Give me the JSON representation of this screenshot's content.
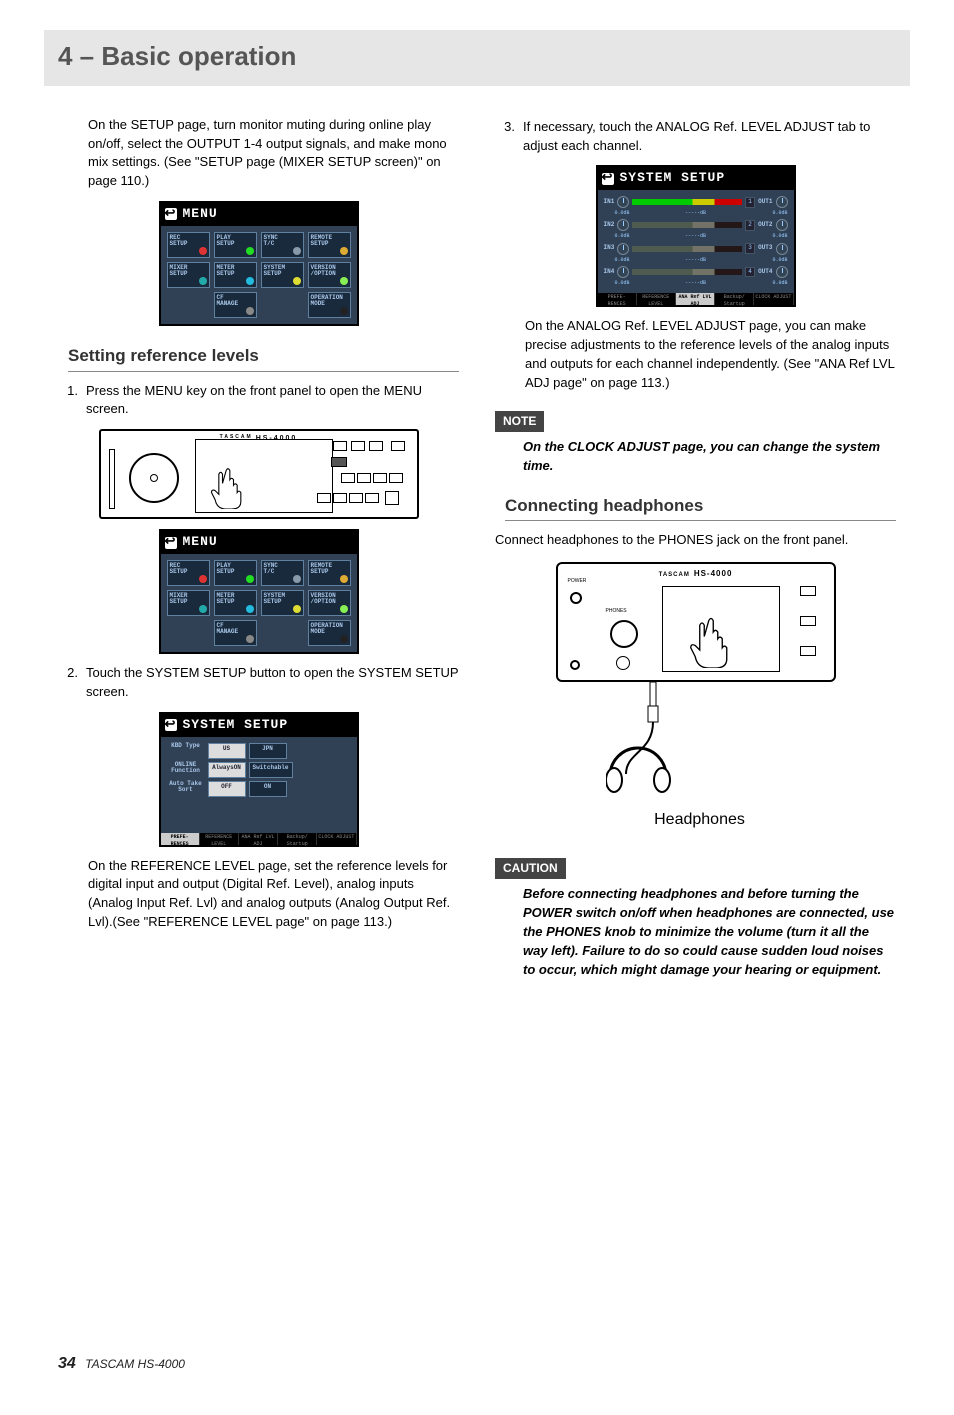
{
  "chapter_title": "4 – Basic operation",
  "left": {
    "intro": "On the SETUP page, turn monitor muting during online play on/off, select the OUTPUT 1-4 output signals, and make mono mix settings. (See \"SETUP page (MIXER SETUP screen)\" on page 110.)",
    "section_title": "Setting reference levels",
    "steps": [
      "Press the MENU key on the front panel to open the MENU screen.",
      "Touch the SYSTEM SETUP button to open the SYSTEM SETUP screen."
    ],
    "ref_para": "On the REFERENCE LEVEL page, set the reference levels for digital input and output (Digital Ref. Level), analog inputs (Analog Input Ref. Lvl) and analog outputs (Analog Output Ref. Lvl).(See \"REFERENCE LEVEL page\" on page 113.)"
  },
  "panel_model": "HS-4000",
  "menu": {
    "title": "MENU",
    "buttons": [
      {
        "label": "REC\nSETUP",
        "dot": "#d33"
      },
      {
        "label": "PLAY\nSETUP",
        "dot": "#2d2"
      },
      {
        "label": "SYNC\nT/C",
        "dot": "#89a"
      },
      {
        "label": "REMOTE\nSETUP",
        "dot": "#da3"
      },
      {
        "label": "MIXER\nSETUP",
        "dot": "#2aa"
      },
      {
        "label": "METER\nSETUP",
        "dot": "#2bd"
      },
      {
        "label": "SYSTEM\nSETUP",
        "dot": "#dd3"
      },
      {
        "label": "VERSION\n/OPTION",
        "dot": "#8e5"
      },
      {
        "label": "",
        "gap": true
      },
      {
        "label": "CF\nMANAGE",
        "dot": "#888"
      },
      {
        "label": "",
        "gap": true
      },
      {
        "label": "OPERATION\nMODE",
        "dot": "#222"
      }
    ]
  },
  "system_setup": {
    "title": "SYSTEM SETUP",
    "rows": [
      {
        "label": "KBD\nType",
        "buttons": [
          {
            "t": "US",
            "hi": true
          },
          {
            "t": "JPN"
          }
        ]
      },
      {
        "label": "ONLINE\nFunction",
        "buttons": [
          {
            "t": "AlwaysON",
            "hi": true
          },
          {
            "t": "Switchable"
          }
        ]
      },
      {
        "label": "Auto\nTake\nSort",
        "buttons": [
          {
            "t": "OFF",
            "hi": true
          },
          {
            "t": "ON"
          }
        ]
      }
    ],
    "tabs": [
      "PREFE-\nRENCES",
      "REFERENCE\nLEVEL",
      "ANA Ref\nLVL ADJ",
      "Backup/\nStartup",
      "CLOCK\nADJUST"
    ],
    "active_tab": 0
  },
  "right": {
    "step3": "If necessary, touch the ANALOG Ref. LEVEL ADJUST tab to adjust each channel.",
    "ana_para": "On the ANALOG Ref. LEVEL ADJUST page, you can make precise adjustments to the reference levels of the analog inputs and outputs for each channel independently. (See \"ANA Ref LVL ADJ page\" on page 113.)",
    "note_label": "NOTE",
    "note_body": "On the CLOCK ADJUST page, you can change the system time.",
    "conn_title": "Connecting headphones",
    "conn_para": "Connect headphones to the PHONES jack on the front panel.",
    "hp_label": "Headphones",
    "caution_label": "CAUTION",
    "caution_body": "Before connecting headphones and before turning the POWER switch on/off when headphones are connected, use the PHONES knob to minimize the volume (turn it all the way left).  Failure to do so could cause sudden loud noises to occur, which might damage your hearing or equipment."
  },
  "ana_adjust": {
    "title": "SYSTEM SETUP",
    "channels": [
      {
        "in": "IN1",
        "in_db": "0.0dB",
        "meter": "-----dB",
        "idx": "1",
        "out": "OUT1",
        "out_db": "0.0dB"
      },
      {
        "in": "IN2",
        "in_db": "0.0dB",
        "meter": "-----dB",
        "idx": "2",
        "out": "OUT2",
        "out_db": "0.0dB"
      },
      {
        "in": "IN3",
        "in_db": "0.0dB",
        "meter": "-----dB",
        "idx": "3",
        "out": "OUT3",
        "out_db": "0.0dB"
      },
      {
        "in": "IN4",
        "in_db": "0.0dB",
        "meter": "-----dB",
        "idx": "4",
        "out": "OUT4",
        "out_db": "0.0dB"
      }
    ],
    "tabs": [
      "PREFE-\nRENCES",
      "REFERENCE\nLEVEL",
      "ANA Ref\nLVL ADJ",
      "Backup/\nStartup",
      "CLOCK\nADJUST"
    ],
    "active_tab": 2
  },
  "hp_panel": {
    "brand": "TASCAM",
    "model": "HS-4000"
  },
  "footer": {
    "page": "34",
    "tail": "TASCAM  HS-4000"
  }
}
